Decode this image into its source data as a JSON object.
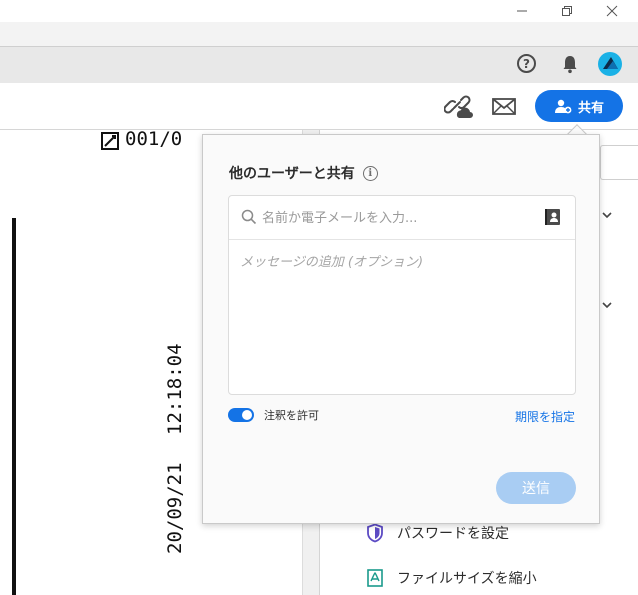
{
  "window": {
    "minimize_icon": "minimize-icon",
    "restore_icon": "restore-icon",
    "close_icon": "close-icon"
  },
  "global_toolbar": {
    "help_label": "?",
    "bell_icon": "bell-icon",
    "avatar_color": "#1ab1e6"
  },
  "doc_toolbar": {
    "link_icon": "cloud-link-icon",
    "mail_icon": "envelope-icon",
    "share_label": "共有",
    "share_color": "#1473e6"
  },
  "document": {
    "header_text": "001/0",
    "date_text": "20/09/21",
    "time_text": "12:18:04"
  },
  "right_pane": {
    "items": [
      {
        "label": "パスワードを設定",
        "icon": "shield-icon"
      },
      {
        "label": "ファイルサイズを縮小",
        "icon": "compress-pdf-icon"
      }
    ]
  },
  "share_dialog": {
    "title": "他のユーザーと共有",
    "info_label": "i",
    "recipient_placeholder": "名前か電子メールを入力...",
    "message_placeholder": "メッセージの追加 (オプション)",
    "allow_comments_label": "注釈を許可",
    "allow_comments_enabled": true,
    "deadline_link": "期限を指定",
    "send_label": "送信",
    "send_enabled": false
  }
}
